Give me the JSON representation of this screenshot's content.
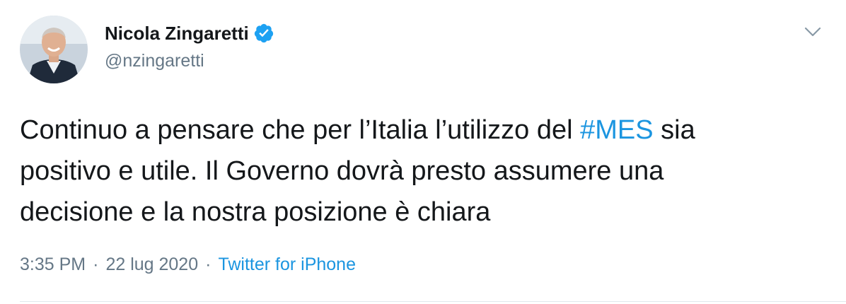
{
  "author": {
    "display_name": "Nicola Zingaretti",
    "handle": "@nzingaretti",
    "verified": true
  },
  "icons": {
    "verified": "verified-badge-icon",
    "menu": "chevron-down-icon"
  },
  "tweet": {
    "text_before": "Continuo a pensare che per l’Italia l’utilizzo del ",
    "hashtag": "#MES",
    "text_line1_end": " sia",
    "text_line2": "positivo e utile. Il Governo dovrà presto assumere una",
    "text_line3": "decisione e la nostra posizione è chiara"
  },
  "meta": {
    "time": "3:35 PM",
    "separator1": "·",
    "date": "22 lug 2020",
    "separator2": "·",
    "source": "Twitter for iPhone"
  },
  "colors": {
    "link": "#1b95e0",
    "secondary_text": "#657786",
    "primary_text": "#14171a",
    "verified_badge": "#1da1f2"
  }
}
